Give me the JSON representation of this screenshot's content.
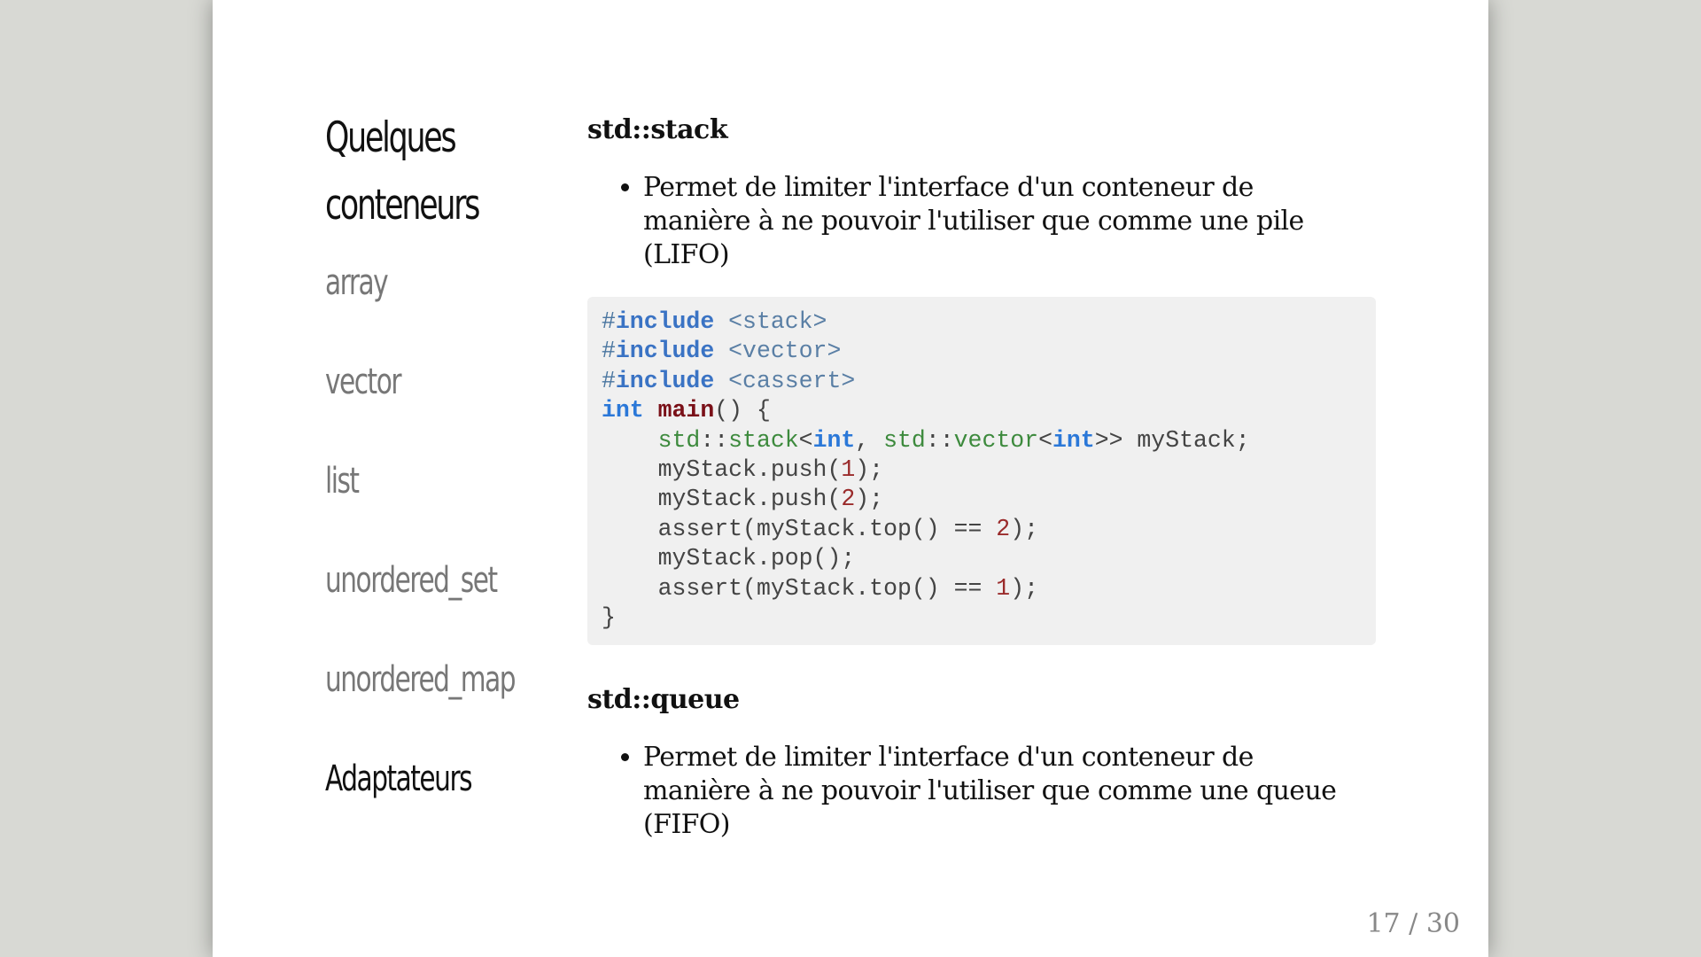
{
  "sidebar": {
    "title_line1": "Quelques",
    "title_line2": "conteneurs",
    "items": [
      {
        "label": "array"
      },
      {
        "label": "vector"
      },
      {
        "label": "list"
      },
      {
        "label": "unordered_set"
      },
      {
        "label": "unordered_map"
      },
      {
        "label": "Adaptateurs"
      }
    ]
  },
  "sections": {
    "stack": {
      "heading": "std::stack",
      "bullet_line1": "Permet de limiter l'interface d'un conteneur de",
      "bullet_line2": "manière à ne pouvoir l'utiliser que comme une pile",
      "bullet_line3": "(LIFO)"
    },
    "queue": {
      "heading": "std::queue",
      "bullet_line1": "Permet de limiter l'interface d'un conteneur de",
      "bullet_line2": "manière à ne pouvoir l'utiliser que comme une queue",
      "bullet_line3": "(FIFO)"
    }
  },
  "code": {
    "hash": "#",
    "include": "include",
    "hdr_stack": "<stack>",
    "hdr_vector": "<vector>",
    "hdr_cassert": "<cassert>",
    "int": "int",
    "main": "main",
    "main_tail": "() {",
    "indent": "    ",
    "std": "std",
    "scope": "::",
    "stack": "stack",
    "lt": "<",
    "comma": ", ",
    "vector": "vector",
    "decl_tail": ">> myStack;",
    "push_head": "myStack.push(",
    "one": "1",
    "two": "2",
    "call_tail": ");",
    "assert_head": "assert(myStack.top() == ",
    "pop_line": "myStack.pop();",
    "close_brace": "}"
  },
  "footer": {
    "page_counter": "17 / 30"
  }
}
